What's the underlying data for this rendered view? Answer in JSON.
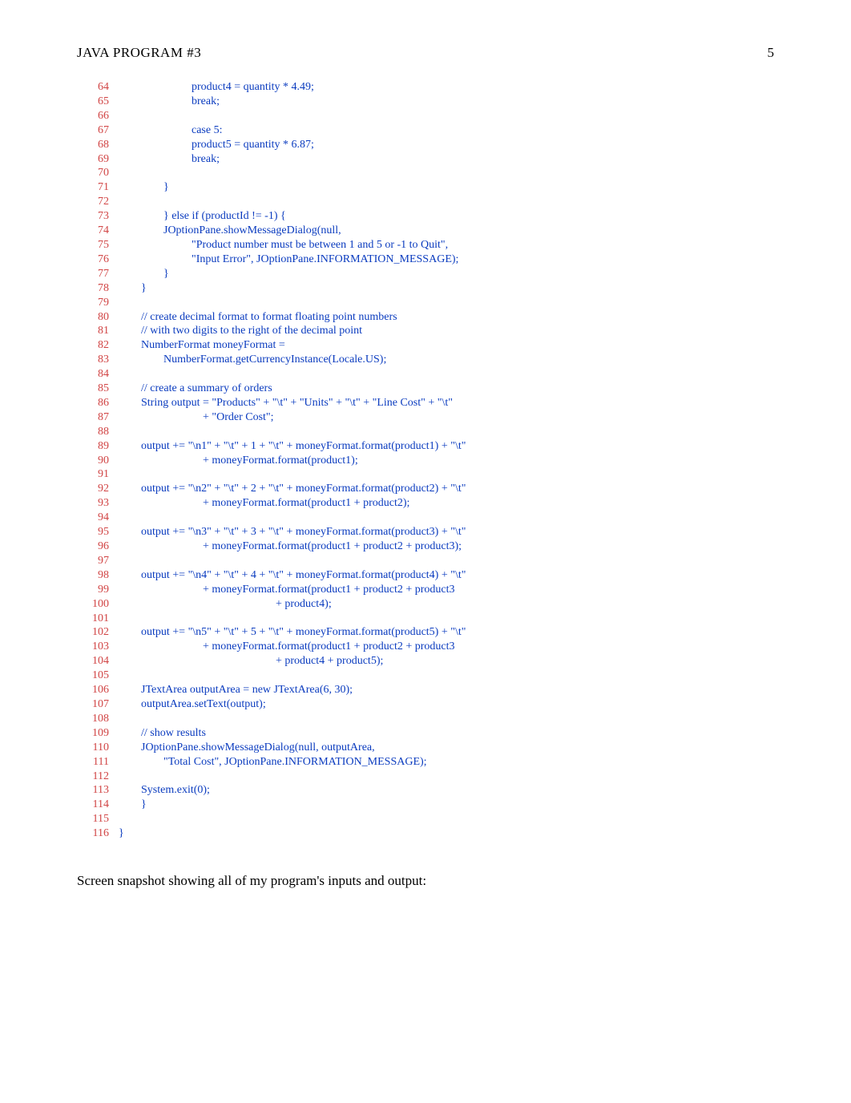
{
  "header": {
    "title": "JAVA PROGRAM #3",
    "page_number": "5"
  },
  "code_lines": [
    {
      "n": "64",
      "t": "                          product4 = quantity * 4.49;"
    },
    {
      "n": "65",
      "t": "                          break;"
    },
    {
      "n": "66",
      "t": ""
    },
    {
      "n": "67",
      "t": "                          case 5:"
    },
    {
      "n": "68",
      "t": "                          product5 = quantity * 6.87;"
    },
    {
      "n": "69",
      "t": "                          break;"
    },
    {
      "n": "70",
      "t": ""
    },
    {
      "n": "71",
      "t": "                }"
    },
    {
      "n": "72",
      "t": ""
    },
    {
      "n": "73",
      "t": "                } else if (productId != -1) {"
    },
    {
      "n": "74",
      "t": "                JOptionPane.showMessageDialog(null,"
    },
    {
      "n": "75",
      "t": "                          \"Product number must be between 1 and 5 or -1 to Quit\","
    },
    {
      "n": "76",
      "t": "                          \"Input Error\", JOptionPane.INFORMATION_MESSAGE);"
    },
    {
      "n": "77",
      "t": "                }"
    },
    {
      "n": "78",
      "t": "        }"
    },
    {
      "n": "79",
      "t": ""
    },
    {
      "n": "80",
      "t": "        // create decimal format to format floating point numbers"
    },
    {
      "n": "81",
      "t": "        // with two digits to the right of the decimal point"
    },
    {
      "n": "82",
      "t": "        NumberFormat moneyFormat ="
    },
    {
      "n": "83",
      "t": "                NumberFormat.getCurrencyInstance(Locale.US);"
    },
    {
      "n": "84",
      "t": ""
    },
    {
      "n": "85",
      "t": "        // create a summary of orders"
    },
    {
      "n": "86",
      "t": "        String output = \"Products\" + \"\\t\" + \"Units\" + \"\\t\" + \"Line Cost\" + \"\\t\""
    },
    {
      "n": "87",
      "t": "                              + \"Order Cost\";"
    },
    {
      "n": "88",
      "t": ""
    },
    {
      "n": "89",
      "t": "        output += \"\\n1\" + \"\\t\" + 1 + \"\\t\" + moneyFormat.format(product1) + \"\\t\""
    },
    {
      "n": "90",
      "t": "                              + moneyFormat.format(product1);"
    },
    {
      "n": "91",
      "t": ""
    },
    {
      "n": "92",
      "t": "        output += \"\\n2\" + \"\\t\" + 2 + \"\\t\" + moneyFormat.format(product2) + \"\\t\""
    },
    {
      "n": "93",
      "t": "                              + moneyFormat.format(product1 + product2);"
    },
    {
      "n": "94",
      "t": ""
    },
    {
      "n": "95",
      "t": "        output += \"\\n3\" + \"\\t\" + 3 + \"\\t\" + moneyFormat.format(product3) + \"\\t\""
    },
    {
      "n": "96",
      "t": "                              + moneyFormat.format(product1 + product2 + product3);"
    },
    {
      "n": "97",
      "t": ""
    },
    {
      "n": "98",
      "t": "        output += \"\\n4\" + \"\\t\" + 4 + \"\\t\" + moneyFormat.format(product4) + \"\\t\""
    },
    {
      "n": "99",
      "t": "                              + moneyFormat.format(product1 + product2 + product3"
    },
    {
      "n": "100",
      "t": "                                                        + product4);"
    },
    {
      "n": "101",
      "t": ""
    },
    {
      "n": "102",
      "t": "        output += \"\\n5\" + \"\\t\" + 5 + \"\\t\" + moneyFormat.format(product5) + \"\\t\""
    },
    {
      "n": "103",
      "t": "                              + moneyFormat.format(product1 + product2 + product3"
    },
    {
      "n": "104",
      "t": "                                                        + product4 + product5);"
    },
    {
      "n": "105",
      "t": ""
    },
    {
      "n": "106",
      "t": "        JTextArea outputArea = new JTextArea(6, 30);"
    },
    {
      "n": "107",
      "t": "        outputArea.setText(output);"
    },
    {
      "n": "108",
      "t": ""
    },
    {
      "n": "109",
      "t": "        // show results"
    },
    {
      "n": "110",
      "t": "        JOptionPane.showMessageDialog(null, outputArea,"
    },
    {
      "n": "111",
      "t": "                \"Total Cost\", JOptionPane.INFORMATION_MESSAGE);"
    },
    {
      "n": "112",
      "t": ""
    },
    {
      "n": "113",
      "t": "        System.exit(0);"
    },
    {
      "n": "114",
      "t": "        }"
    },
    {
      "n": "115",
      "t": ""
    },
    {
      "n": "116",
      "t": "}"
    }
  ],
  "caption": "Screen snapshot showing all of my program's inputs and output:"
}
